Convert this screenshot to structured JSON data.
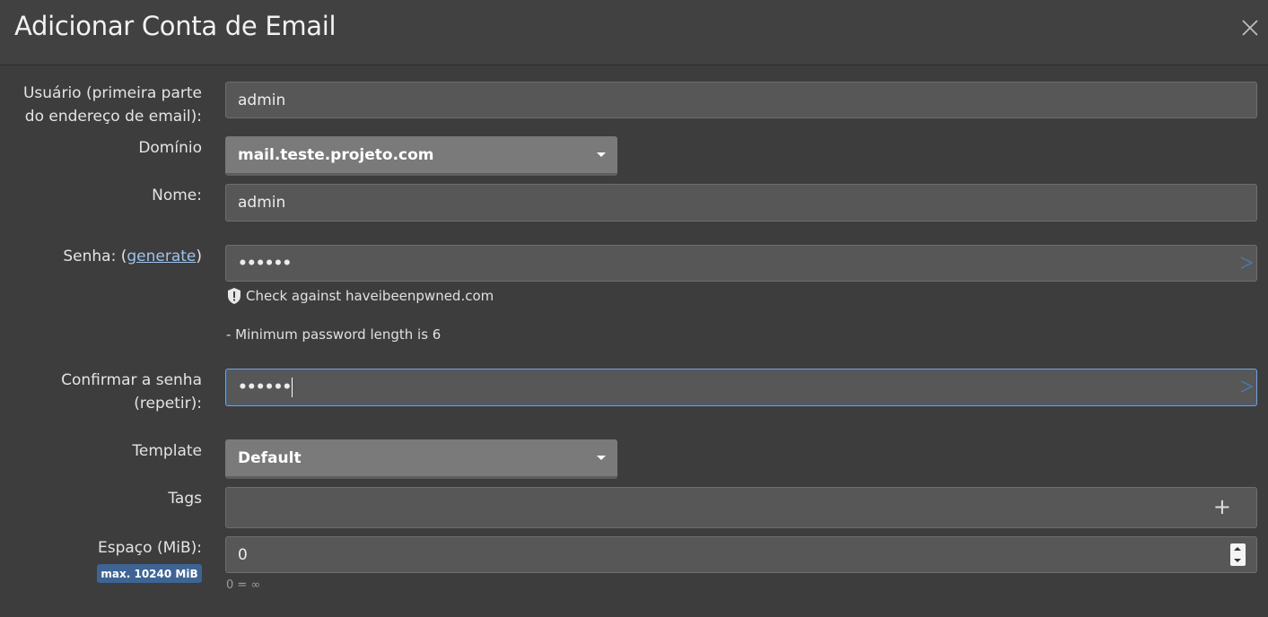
{
  "dialog": {
    "title": "Adicionar Conta de Email"
  },
  "form": {
    "username": {
      "label_line1": "Usuário (primeira parte",
      "label_line2": "do endereço de email):",
      "value": "admin"
    },
    "domain": {
      "label": "Domínio",
      "selected": "mail.teste.projeto.com"
    },
    "name": {
      "label": "Nome:",
      "value": "admin"
    },
    "password": {
      "label_prefix": "Senha: (",
      "generate_link": "generate",
      "label_suffix": ")",
      "value": "••••••",
      "hibp_check": "Check against haveibeenpwned.com",
      "min_length_hint": "- Minimum password length is 6"
    },
    "confirm_password": {
      "label_line1": "Confirmar a senha",
      "label_line2": "(repetir):",
      "value": "••••••"
    },
    "template": {
      "label": "Template",
      "selected": "Default"
    },
    "tags": {
      "label": "Tags",
      "add_icon": "+"
    },
    "quota": {
      "label": "Espaço (MiB):",
      "max_badge": "max. 10240 MiB",
      "value": "0",
      "hint": "0 = ∞"
    }
  },
  "colors": {
    "background": "#3d3d3d",
    "input_bg": "#575757",
    "select_bg": "#7a7a7a",
    "badge_bg": "#3e6494",
    "link": "#9ec3ec"
  }
}
